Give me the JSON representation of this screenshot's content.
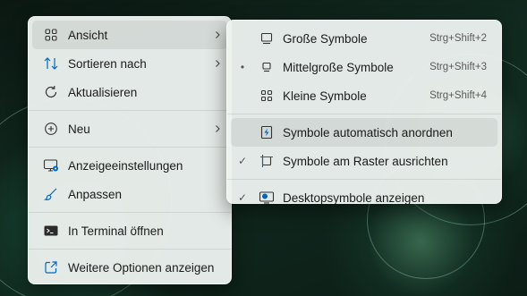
{
  "context_menu": {
    "items": [
      {
        "label": "Ansicht",
        "icon": "grid-view-icon",
        "has_submenu": true,
        "active": true
      },
      {
        "label": "Sortieren nach",
        "icon": "sort-arrows-icon",
        "has_submenu": true
      },
      {
        "label": "Aktualisieren",
        "icon": "refresh-icon",
        "has_submenu": false
      },
      {
        "label": "Neu",
        "icon": "plus-circle-icon",
        "has_submenu": true
      },
      {
        "label": "Anzeigeeinstellungen",
        "icon": "display-settings-icon",
        "has_submenu": false
      },
      {
        "label": "Anpassen",
        "icon": "brush-icon",
        "has_submenu": false
      },
      {
        "label": "In Terminal öffnen",
        "icon": "terminal-icon",
        "has_submenu": false
      },
      {
        "label": "Weitere Optionen anzeigen",
        "icon": "open-external-icon",
        "has_submenu": false
      }
    ]
  },
  "view_submenu": {
    "items": [
      {
        "label": "Große Symbole",
        "shortcut": "Strg+Shift+2",
        "icon": "monitor-large-icon",
        "mark": ""
      },
      {
        "label": "Mittelgroße Symbole",
        "shortcut": "Strg+Shift+3",
        "icon": "monitor-medium-icon",
        "mark": "•"
      },
      {
        "label": "Kleine Symbole",
        "shortcut": "Strg+Shift+4",
        "icon": "grid-small-icon",
        "mark": ""
      },
      {
        "label": "Symbole automatisch anordnen",
        "shortcut": "",
        "icon": "auto-arrange-icon",
        "mark": ""
      },
      {
        "label": "Symbole am Raster ausrichten",
        "shortcut": "",
        "icon": "align-grid-icon",
        "mark": "✓"
      },
      {
        "label": "Desktopsymbole anzeigen",
        "shortcut": "",
        "icon": "desktop-icons-icon",
        "mark": "✓"
      }
    ]
  },
  "colors": {
    "accent": "#0067c0",
    "menu_background": "#ecf1ee",
    "text": "#1b1b1b"
  }
}
